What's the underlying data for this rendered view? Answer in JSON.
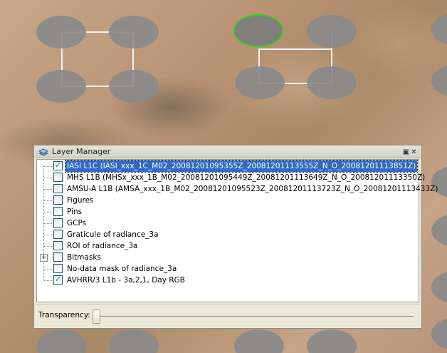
{
  "layer_manager": {
    "title": "Layer Manager",
    "layers": [
      {
        "label": "IASI L1C (IASI_xxx_1C_M02_20081201095355Z_20081201113555Z_N_O_20081201113851Z)",
        "checked": true,
        "selected": true
      },
      {
        "label": "MHS L1B (MHSx_xxx_1B_M02_20081201095449Z_20081201113649Z_N_O_20081201113350Z)",
        "checked": false
      },
      {
        "label": "AMSU-A L1B (AMSA_xxx_1B_M02_20081201095523Z_20081201113723Z_N_O_20081201113433Z)",
        "checked": false
      },
      {
        "label": "Figures",
        "checked": false
      },
      {
        "label": "Pins",
        "checked": false
      },
      {
        "label": "GCPs",
        "checked": false
      },
      {
        "label": "Graticule of radiance_3a",
        "checked": false
      },
      {
        "label": "ROI of radiance_3a",
        "checked": false
      },
      {
        "label": "Bitmasks",
        "checked": false,
        "expandable": true
      },
      {
        "label": "No-data mask of radiance_3a",
        "checked": false
      },
      {
        "label": "AVHRR/3 L1b - 3a,2,1, Day RGB",
        "checked": true
      }
    ],
    "transparency_label": "Transparency:",
    "transparency_value": 0
  },
  "colors": {
    "selection": "#316ac5",
    "selected_footprint": "#33cc22",
    "footprint": "#8a8a8a"
  }
}
